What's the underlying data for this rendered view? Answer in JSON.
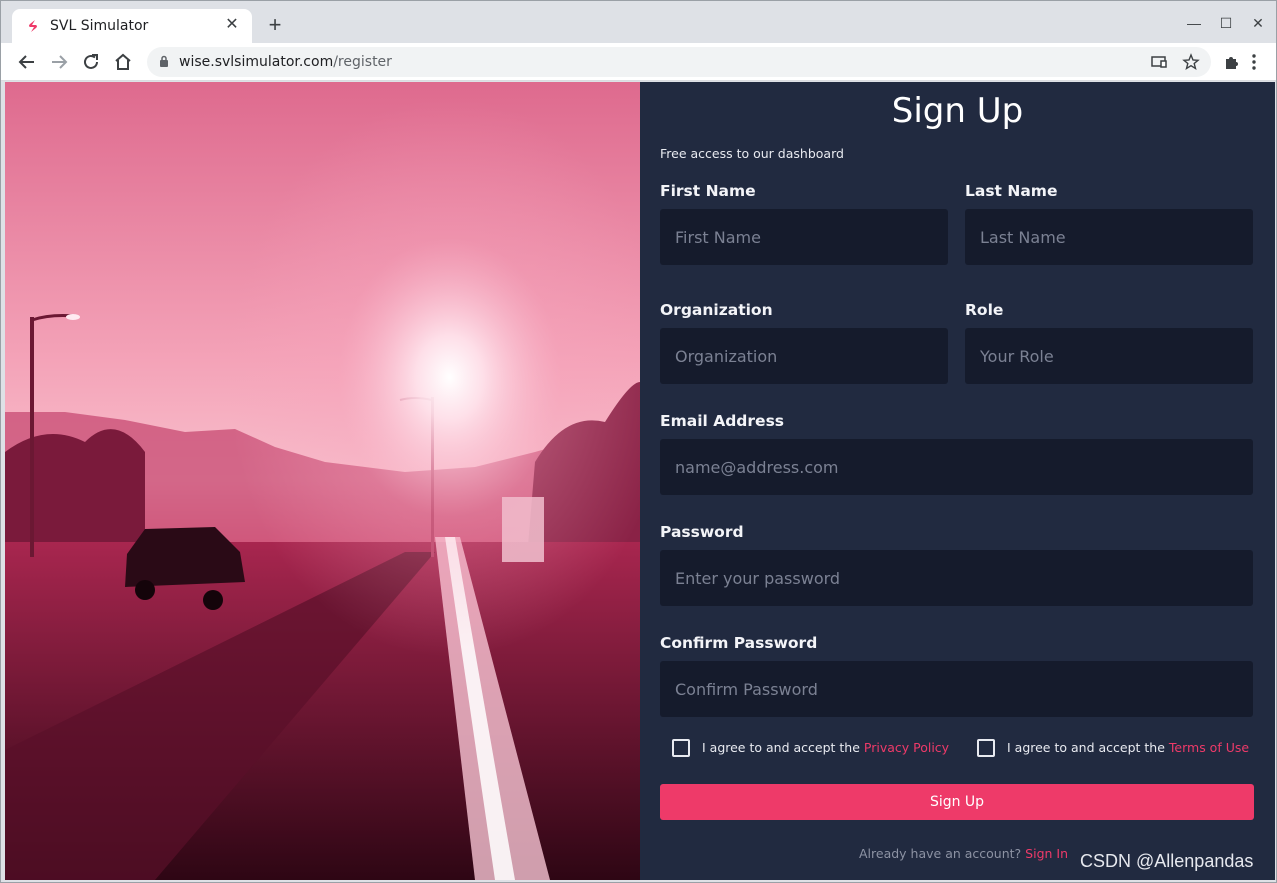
{
  "browser": {
    "tab_title": "SVL Simulator",
    "url_host": "wise.svlsimulator.com",
    "url_path": "/register",
    "tab_close_label": "✕",
    "new_tab_label": "+",
    "minimize_label": "—",
    "maximize_label": "☐",
    "close_label": "✕",
    "icons": [
      "back-icon",
      "forward-icon",
      "reload-icon",
      "home-icon",
      "lock-icon",
      "cast-icon",
      "star-icon",
      "extensions-icon",
      "menu-icon"
    ]
  },
  "form": {
    "title": "Sign Up",
    "subtitle": "Free access to our dashboard",
    "first_name": {
      "label": "First Name",
      "placeholder": "First Name"
    },
    "last_name": {
      "label": "Last Name",
      "placeholder": "Last Name"
    },
    "organization": {
      "label": "Organization",
      "placeholder": "Organization"
    },
    "role": {
      "label": "Role",
      "placeholder": "Your Role"
    },
    "email": {
      "label": "Email Address",
      "placeholder": "name@address.com"
    },
    "password": {
      "label": "Password",
      "placeholder": "Enter your password"
    },
    "confirm_password": {
      "label": "Confirm Password",
      "placeholder": "Confirm Password"
    },
    "privacy": {
      "text": "I agree to and accept the ",
      "link": "Privacy Policy"
    },
    "terms": {
      "text": "I agree to and accept the ",
      "link": "Terms of Use"
    },
    "submit_label": "Sign Up",
    "signin_prompt": "Already have an account? ",
    "signin_link": "Sign In"
  },
  "watermark": "CSDN @Allenpandas",
  "colors": {
    "accent": "#ee3a69",
    "panel_bg": "#212a40",
    "field_bg": "#151b2c"
  }
}
